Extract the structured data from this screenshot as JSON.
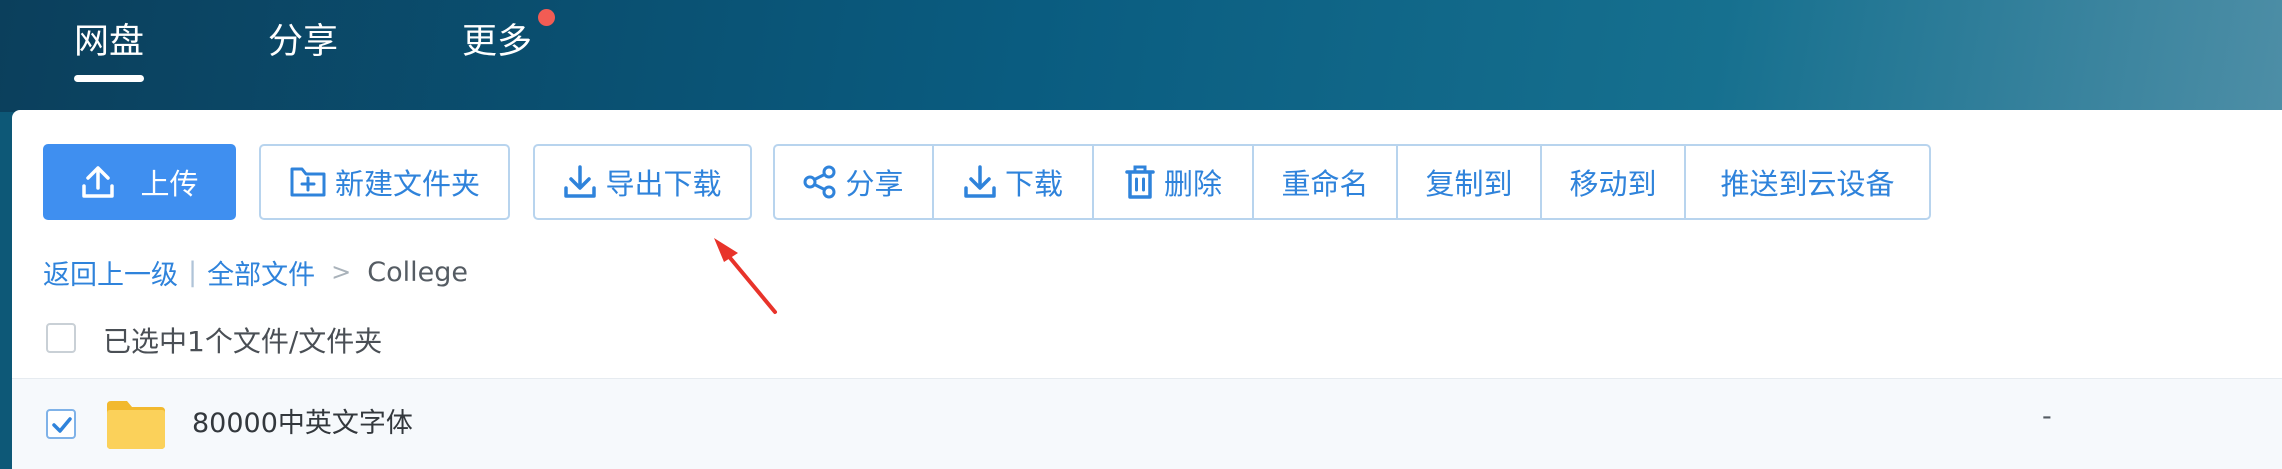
{
  "nav": {
    "tabs": [
      {
        "label": "网盘",
        "active": true
      },
      {
        "label": "分享",
        "active": false
      },
      {
        "label": "更多",
        "active": false,
        "badge": "notification-dot"
      }
    ]
  },
  "toolbar": {
    "upload": "上传",
    "new_folder": "新建文件夹",
    "export_download": "导出下载",
    "share": "分享",
    "download": "下载",
    "delete": "删除",
    "rename": "重命名",
    "copy_to": "复制到",
    "move_to": "移动到",
    "push_to_cloud_device": "推送到云设备"
  },
  "breadcrumb": {
    "back": "返回上一级",
    "separator": "|",
    "all_files": "全部文件",
    "arrow": ">",
    "current": "College"
  },
  "selection": {
    "label": "已选中1个文件/文件夹"
  },
  "files": [
    {
      "name": "80000中英文字体",
      "size": "-",
      "checked": true,
      "type": "folder"
    }
  ],
  "colors": {
    "accent": "#3f8ff0",
    "link": "#2f83db",
    "annotation_arrow": "#e8332a",
    "folder": "#f9cb4a"
  }
}
